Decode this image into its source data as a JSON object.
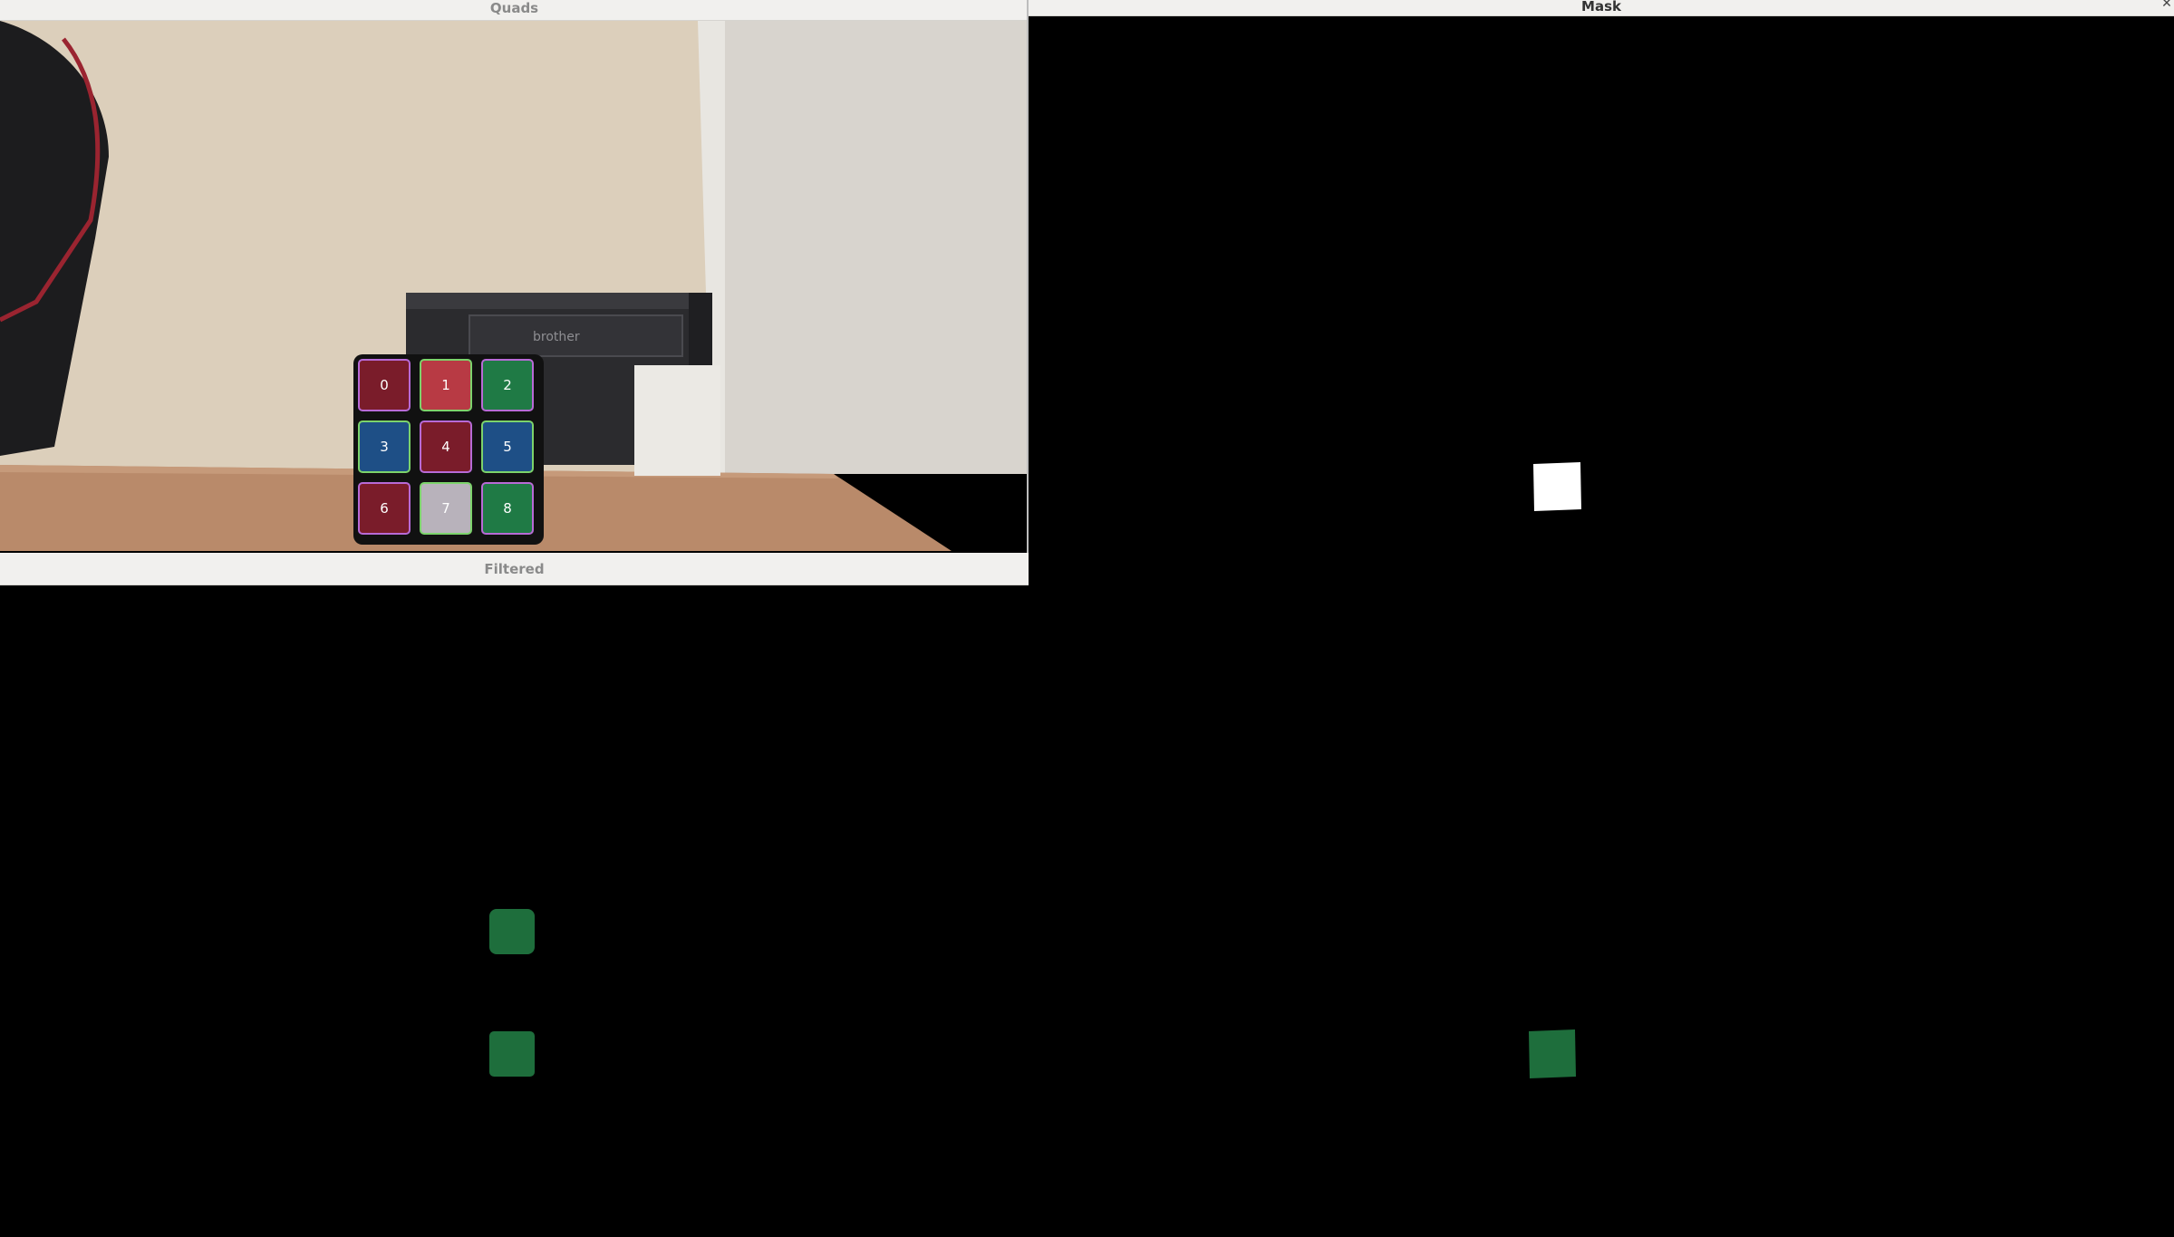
{
  "windows": {
    "quads": {
      "title": "Quads"
    },
    "filtered": {
      "title": "Filtered"
    },
    "mask": {
      "title": "Mask"
    }
  },
  "cube_detection": {
    "stickers": [
      {
        "label": "0",
        "color": "#7a1c2a"
      },
      {
        "label": "1",
        "color": "#b83a44"
      },
      {
        "label": "2",
        "color": "#1f7a45"
      },
      {
        "label": "3",
        "color": "#1e4f86"
      },
      {
        "label": "4",
        "color": "#7a1c2a"
      },
      {
        "label": "5",
        "color": "#1e4f86"
      },
      {
        "label": "6",
        "color": "#7a1c2a"
      },
      {
        "label": "7",
        "color": "#b8b2bb"
      },
      {
        "label": "8",
        "color": "#1f7a45"
      }
    ]
  },
  "colors": {
    "titlebar_bg": "#f1f0ee",
    "mask_blob": "#ffffff",
    "filtered_green": "#1e6e3c"
  },
  "icons": {
    "close": "close-icon"
  }
}
